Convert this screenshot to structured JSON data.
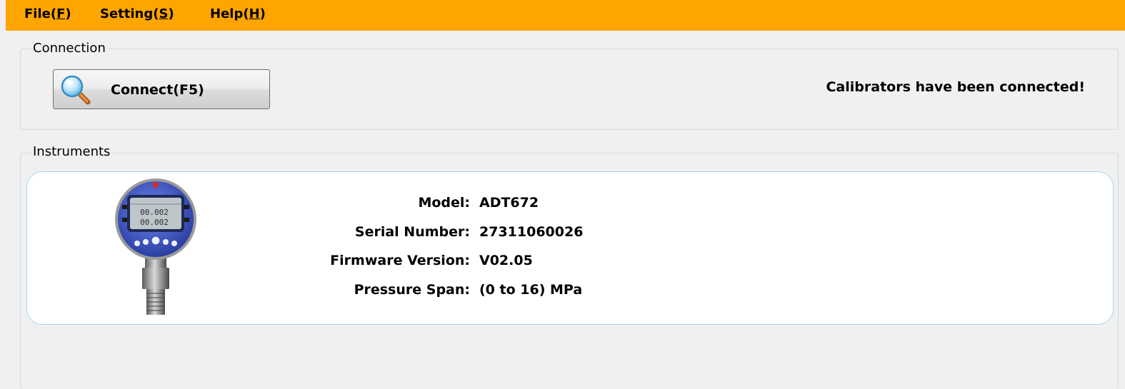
{
  "menu": [
    {
      "prefix": "File(",
      "key": "F",
      "suffix": ")"
    },
    {
      "prefix": "Setting(",
      "key": "S",
      "suffix": ")"
    },
    {
      "prefix": "Help(",
      "key": "H",
      "suffix": ")"
    }
  ],
  "connection": {
    "group_label": "Connection",
    "connect_label": "Connect(F5)",
    "status": "Calibrators have been connected!",
    "icon": "magnifier-icon"
  },
  "instruments": {
    "group_label": "Instruments",
    "device_image": "pressure-gauge-icon",
    "display_reading": "00.002",
    "fields": [
      {
        "label": "Model:",
        "value": "ADT672"
      },
      {
        "label": "Serial Number:",
        "value": "27311060026"
      },
      {
        "label": "Firmware Version:",
        "value": "V02.05"
      },
      {
        "label": "Pressure Span:",
        "value": "(0 to 16) MPa"
      }
    ]
  },
  "colors": {
    "menubar": "#fea500",
    "card_border": "#a9d5ec",
    "window_bg": "#f0f0f0"
  }
}
